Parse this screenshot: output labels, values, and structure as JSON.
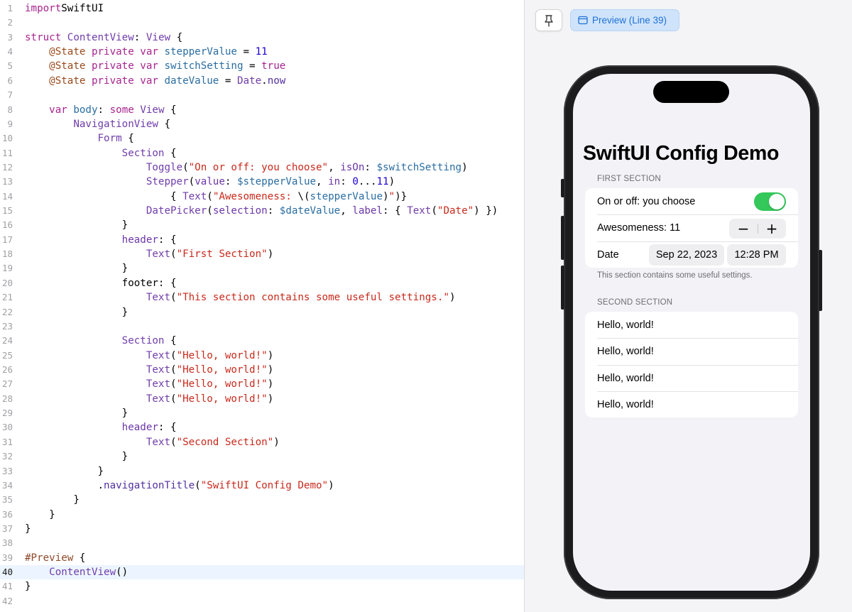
{
  "editor": {
    "current_line": 40,
    "lines": [
      {
        "n": "1",
        "t": [
          [
            "kw",
            "import"
          ],
          [
            "",
            "SwiftUI"
          ]
        ]
      },
      {
        "n": "2",
        "t": []
      },
      {
        "n": "3",
        "t": [
          [
            "kw",
            "struct "
          ],
          [
            "ty",
            "ContentView"
          ],
          [
            "",
            ": "
          ],
          [
            "ty",
            "View"
          ],
          [
            "",
            " {"
          ]
        ]
      },
      {
        "n": "4",
        "t": [
          [
            "",
            "    "
          ],
          [
            "attr",
            "@State "
          ],
          [
            "kw",
            "private var "
          ],
          [
            "id",
            "stepperValue"
          ],
          [
            "",
            " = "
          ],
          [
            "num",
            "11"
          ]
        ]
      },
      {
        "n": "5",
        "t": [
          [
            "",
            "    "
          ],
          [
            "attr",
            "@State "
          ],
          [
            "kw",
            "private var "
          ],
          [
            "id",
            "switchSetting"
          ],
          [
            "",
            " = "
          ],
          [
            "kw",
            "true"
          ]
        ]
      },
      {
        "n": "6",
        "t": [
          [
            "",
            "    "
          ],
          [
            "attr",
            "@State "
          ],
          [
            "kw",
            "private var "
          ],
          [
            "id",
            "dateValue"
          ],
          [
            "",
            " = "
          ],
          [
            "ty",
            "Date"
          ],
          [
            "",
            "."
          ],
          [
            "fn",
            "now"
          ]
        ]
      },
      {
        "n": "7",
        "t": []
      },
      {
        "n": "8",
        "t": [
          [
            "",
            "    "
          ],
          [
            "kw",
            "var "
          ],
          [
            "id",
            "body"
          ],
          [
            "",
            ": "
          ],
          [
            "kw",
            "some "
          ],
          [
            "ty",
            "View"
          ],
          [
            "",
            " {"
          ]
        ]
      },
      {
        "n": "9",
        "t": [
          [
            "",
            "        "
          ],
          [
            "ty",
            "NavigationView"
          ],
          [
            "",
            " {"
          ]
        ]
      },
      {
        "n": "10",
        "t": [
          [
            "",
            "            "
          ],
          [
            "ty",
            "Form"
          ],
          [
            "",
            " {"
          ]
        ]
      },
      {
        "n": "11",
        "t": [
          [
            "",
            "                "
          ],
          [
            "ty",
            "Section"
          ],
          [
            "",
            " {"
          ]
        ]
      },
      {
        "n": "12",
        "t": [
          [
            "",
            "                    "
          ],
          [
            "ty",
            "Toggle"
          ],
          [
            "",
            "("
          ],
          [
            "str",
            "\"On or off: you choose\""
          ],
          [
            "",
            ", "
          ],
          [
            "param",
            "isOn"
          ],
          [
            "",
            ": "
          ],
          [
            "id",
            "$switchSetting"
          ],
          [
            "",
            ")"
          ]
        ]
      },
      {
        "n": "13",
        "t": [
          [
            "",
            "                    "
          ],
          [
            "ty",
            "Stepper"
          ],
          [
            "",
            "("
          ],
          [
            "param",
            "value"
          ],
          [
            "",
            ": "
          ],
          [
            "id",
            "$stepperValue"
          ],
          [
            "",
            ", "
          ],
          [
            "param",
            "in"
          ],
          [
            "",
            ": "
          ],
          [
            "num",
            "0"
          ],
          [
            "",
            "..."
          ],
          [
            "num",
            "11"
          ],
          [
            "",
            ")"
          ]
        ]
      },
      {
        "n": "14",
        "t": [
          [
            "",
            "                        { "
          ],
          [
            "ty",
            "Text"
          ],
          [
            "",
            "("
          ],
          [
            "str",
            "\"Awesomeness: "
          ],
          [
            "",
            "\\("
          ],
          [
            "id",
            "stepperValue"
          ],
          [
            "",
            ")"
          ],
          [
            "str",
            "\""
          ],
          [
            "",
            ")}"
          ]
        ]
      },
      {
        "n": "15",
        "t": [
          [
            "",
            "                    "
          ],
          [
            "ty",
            "DatePicker"
          ],
          [
            "",
            "("
          ],
          [
            "param",
            "selection"
          ],
          [
            "",
            ": "
          ],
          [
            "id",
            "$dateValue"
          ],
          [
            "",
            ", "
          ],
          [
            "param",
            "label"
          ],
          [
            "",
            ": { "
          ],
          [
            "ty",
            "Text"
          ],
          [
            "",
            "("
          ],
          [
            "str",
            "\"Date\""
          ],
          [
            "",
            ") })"
          ]
        ]
      },
      {
        "n": "16",
        "t": [
          [
            "",
            "                }"
          ]
        ]
      },
      {
        "n": "17",
        "t": [
          [
            "",
            "                "
          ],
          [
            "param",
            "header"
          ],
          [
            "",
            ": {"
          ]
        ]
      },
      {
        "n": "18",
        "t": [
          [
            "",
            "                    "
          ],
          [
            "ty",
            "Text"
          ],
          [
            "",
            "("
          ],
          [
            "str",
            "\"First Section\""
          ],
          [
            "",
            ")"
          ]
        ]
      },
      {
        "n": "19",
        "t": [
          [
            "",
            "                }"
          ]
        ]
      },
      {
        "n": "20",
        "t": [
          [
            "",
            "                "
          ],
          [
            "",
            "footer"
          ],
          [
            "",
            ": {"
          ]
        ]
      },
      {
        "n": "21",
        "t": [
          [
            "",
            "                    "
          ],
          [
            "ty",
            "Text"
          ],
          [
            "",
            "("
          ],
          [
            "str",
            "\"This section contains some useful settings.\""
          ],
          [
            "",
            ")"
          ]
        ]
      },
      {
        "n": "22",
        "t": [
          [
            "",
            "                }"
          ]
        ]
      },
      {
        "n": "23",
        "t": []
      },
      {
        "n": "24",
        "t": [
          [
            "",
            "                "
          ],
          [
            "ty",
            "Section"
          ],
          [
            "",
            " {"
          ]
        ]
      },
      {
        "n": "25",
        "t": [
          [
            "",
            "                    "
          ],
          [
            "ty",
            "Text"
          ],
          [
            "",
            "("
          ],
          [
            "str",
            "\"Hello, world!\""
          ],
          [
            "",
            ")"
          ]
        ]
      },
      {
        "n": "26",
        "t": [
          [
            "",
            "                    "
          ],
          [
            "ty",
            "Text"
          ],
          [
            "",
            "("
          ],
          [
            "str",
            "\"Hello, world!\""
          ],
          [
            "",
            ")"
          ]
        ]
      },
      {
        "n": "27",
        "t": [
          [
            "",
            "                    "
          ],
          [
            "ty",
            "Text"
          ],
          [
            "",
            "("
          ],
          [
            "str",
            "\"Hello, world!\""
          ],
          [
            "",
            ")"
          ]
        ]
      },
      {
        "n": "28",
        "t": [
          [
            "",
            "                    "
          ],
          [
            "ty",
            "Text"
          ],
          [
            "",
            "("
          ],
          [
            "str",
            "\"Hello, world!\""
          ],
          [
            "",
            ")"
          ]
        ]
      },
      {
        "n": "29",
        "t": [
          [
            "",
            "                }"
          ]
        ]
      },
      {
        "n": "30",
        "t": [
          [
            "",
            "                "
          ],
          [
            "param",
            "header"
          ],
          [
            "",
            ": {"
          ]
        ]
      },
      {
        "n": "31",
        "t": [
          [
            "",
            "                    "
          ],
          [
            "ty",
            "Text"
          ],
          [
            "",
            "("
          ],
          [
            "str",
            "\"Second Section\""
          ],
          [
            "",
            ")"
          ]
        ]
      },
      {
        "n": "32",
        "t": [
          [
            "",
            "                }"
          ]
        ]
      },
      {
        "n": "33",
        "t": [
          [
            "",
            "            }"
          ]
        ]
      },
      {
        "n": "34",
        "t": [
          [
            "",
            "            ."
          ],
          [
            "fn",
            "navigationTitle"
          ],
          [
            "",
            "("
          ],
          [
            "str",
            "\"SwiftUI Config Demo\""
          ],
          [
            "",
            ")"
          ]
        ]
      },
      {
        "n": "35",
        "t": [
          [
            "",
            "        }"
          ]
        ]
      },
      {
        "n": "36",
        "t": [
          [
            "",
            "    }"
          ]
        ]
      },
      {
        "n": "37",
        "t": [
          [
            "",
            "}"
          ]
        ]
      },
      {
        "n": "38",
        "t": []
      },
      {
        "n": "39",
        "t": [
          [
            "macro",
            "#Preview"
          ],
          [
            "",
            " {"
          ]
        ]
      },
      {
        "n": "40",
        "t": [
          [
            "",
            "    "
          ],
          [
            "ty",
            "ContentView"
          ],
          [
            "",
            "()"
          ]
        ]
      },
      {
        "n": "41",
        "t": [
          [
            "",
            "}"
          ]
        ]
      },
      {
        "n": "42",
        "t": []
      }
    ]
  },
  "canvas": {
    "pin_icon": "pin-icon",
    "preview_label": "Preview (Line 39)",
    "accent": "#1f6fd6"
  },
  "preview": {
    "nav_title": "SwiftUI Config Demo",
    "first_section": {
      "header": "First Section",
      "toggle_label": "On or off: you choose",
      "toggle_on": true,
      "stepper_label": "Awesomeness: 11",
      "stepper_minus": "−",
      "stepper_plus": "+",
      "date_label": "Date",
      "date_value": "Sep 22, 2023",
      "time_value": "12:28 PM",
      "footer": "This section contains some useful settings."
    },
    "second_section": {
      "header": "Second Section",
      "rows": [
        "Hello, world!",
        "Hello, world!",
        "Hello, world!",
        "Hello, world!"
      ]
    },
    "toggle_color": "#34c759"
  }
}
